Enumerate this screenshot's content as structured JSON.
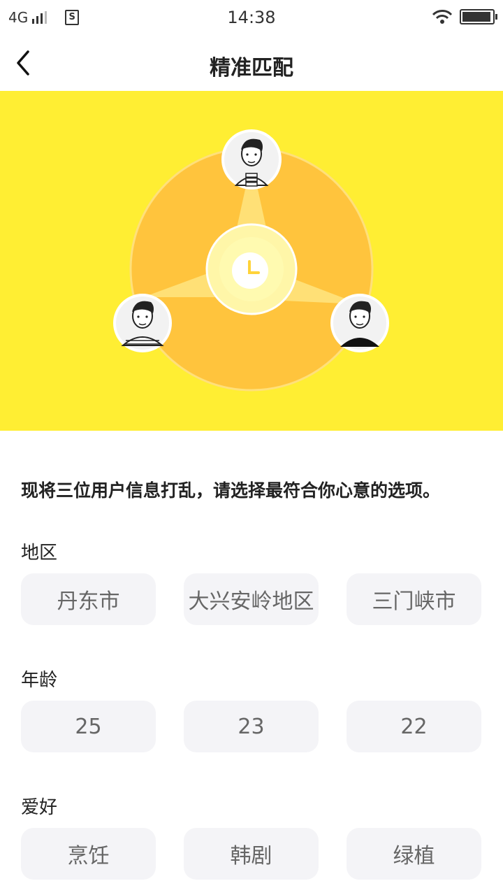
{
  "status_bar": {
    "network": "4G",
    "time": "14:38",
    "sim_icon_label": "S"
  },
  "nav": {
    "title": "精准匹配"
  },
  "instruction": "现将三位用户信息打乱，请选择最符合你心意的选项。",
  "sections": [
    {
      "label": "地区",
      "options": [
        "丹东市",
        "大兴安岭地区",
        "三门峡市"
      ]
    },
    {
      "label": "年龄",
      "options": [
        "25",
        "23",
        "22"
      ]
    },
    {
      "label": "爱好",
      "options": [
        "烹饪",
        "韩剧",
        "绿植"
      ]
    }
  ],
  "colors": {
    "hero_bg": "#FFEE33",
    "circle": "#FFC43D",
    "option_bg": "#F4F4F7"
  }
}
